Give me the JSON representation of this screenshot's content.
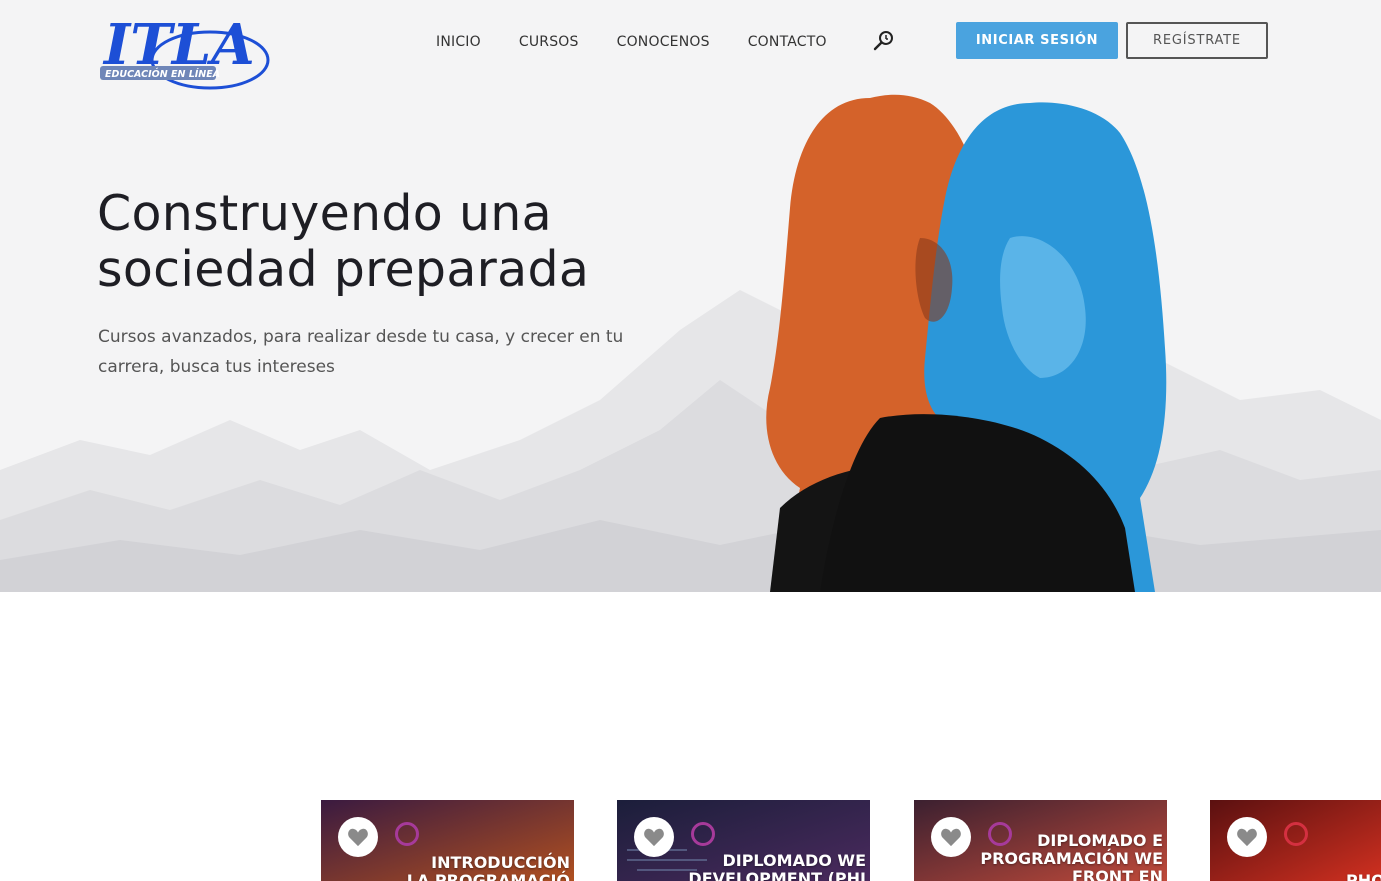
{
  "logo": {
    "main": "ITLA",
    "sub": "EDUCACIÓN EN LÍNEA",
    "color": "#1d4fd6"
  },
  "nav": {
    "items": [
      {
        "label": "INICIO"
      },
      {
        "label": "CURSOS"
      },
      {
        "label": "CONOCENOS"
      },
      {
        "label": "CONTACTO"
      }
    ],
    "search_icon": "search-icon"
  },
  "auth": {
    "login_label": "INICIAR SESIÓN",
    "register_label": "REGÍSTRATE",
    "accent": "#4aa3df"
  },
  "hero": {
    "title_line1": "Construyendo una",
    "title_line2": "sociedad preparada",
    "subtitle_line1": "Cursos avanzados, para realizar desde tu casa, y crecer en tu",
    "subtitle_line2": "carrera, busca tus intereses"
  },
  "courses": [
    {
      "title": "INTRODUCCIÓN\nLA PROGRAMACIÓ",
      "bg": [
        "#3a1a40",
        "#b05020"
      ]
    },
    {
      "title": "DIPLOMADO WE\nDEVELOPMENT (PHI",
      "bg": [
        "#1b1e3a",
        "#4b2a5e"
      ]
    },
    {
      "title": "DIPLOMADO E\nPROGRAMACIÓN WE\nFRONT EN",
      "bg": [
        "#3b2030",
        "#c04a3a"
      ]
    },
    {
      "title": "PHO",
      "bg": [
        "#5a1010",
        "#d03020"
      ]
    }
  ]
}
